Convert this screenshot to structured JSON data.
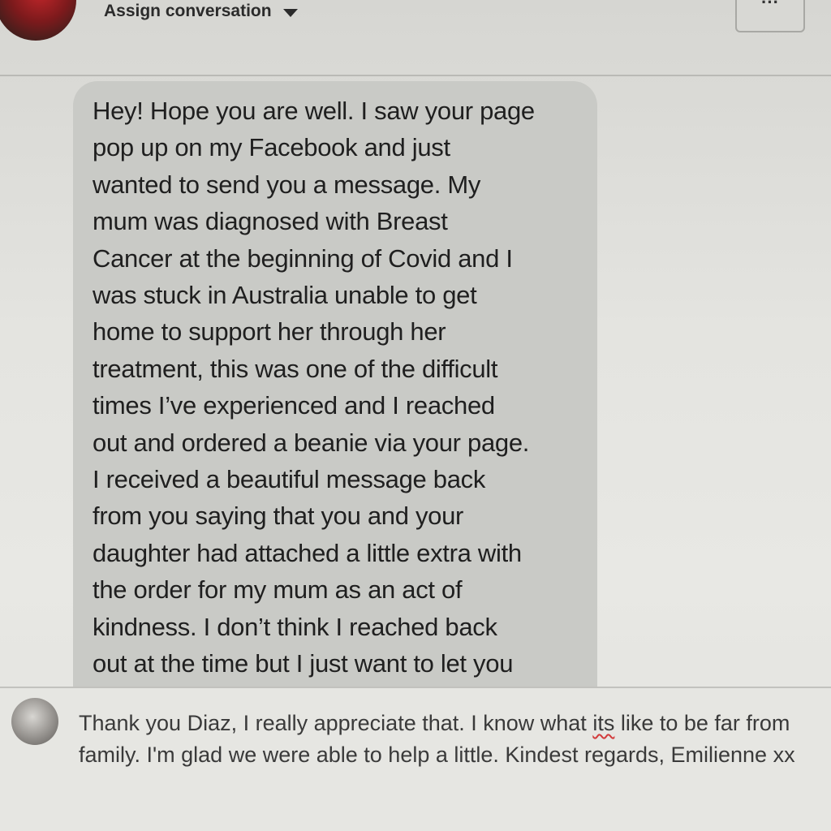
{
  "header": {
    "assign_label": "Assign conversation",
    "more_label": "···"
  },
  "message": {
    "text": "Hey! Hope you are well. I saw your page\npop up on my Facebook and just\nwanted to send you a message. My\nmum was diagnosed with Breast\nCancer at the beginning of Covid and I\nwas stuck in Australia unable to get\nhome to support her through her\ntreatment, this was one of the difficult\ntimes I’ve experienced and I reached\nout and ordered a beanie via your page.\nI received a beautiful message back\nfrom you saying that you and your\ndaughter had attached a little extra with\nthe order for my mum as an act of\nkindness. I don’t think I reached back\nout at the time but I just want to let you"
  },
  "reply": {
    "part1": "Thank you Diaz, I really appreciate that. I know what ",
    "misspelled": "its",
    "part2": " like to be far from family. I'm glad we were able to help a little. Kindest regards, Emilienne xx"
  },
  "colors": {
    "bubble": "#c9cac6",
    "spellcheck_underline": "#d23b3b"
  }
}
